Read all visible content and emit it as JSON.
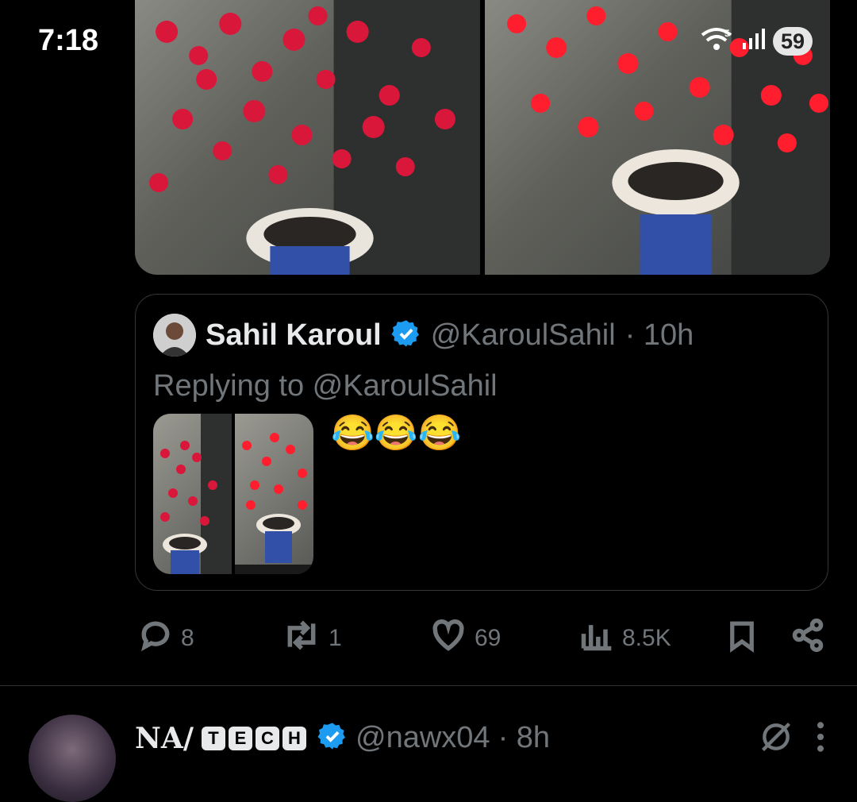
{
  "status_bar": {
    "time": "7:18",
    "battery": "59",
    "wifi_icon": "wifi-icon",
    "signal_icon": "signal-icon"
  },
  "tweet": {
    "media_description": "two-photos",
    "quoted": {
      "name": "Sahil Karoul",
      "handle": "@KaroulSahil",
      "time": "· 10h",
      "verified_color": "#1d9bf0",
      "replying_prefix": "Replying to ",
      "replying_handle": "@KaroulSahil",
      "text": "😂😂😂"
    },
    "actions": {
      "replies": "8",
      "reposts": "1",
      "likes": "69",
      "views": "8.5K"
    }
  },
  "next_tweet": {
    "name_prefix": "NA/",
    "badge_letters": [
      "T",
      "E",
      "C",
      "H"
    ],
    "handle": "@nawx04",
    "time": "· 8h"
  },
  "colors": {
    "background": "#000000",
    "text": "#e7e9ea",
    "muted": "#71767b",
    "border": "#343638",
    "accent": "#1d9bf0"
  }
}
